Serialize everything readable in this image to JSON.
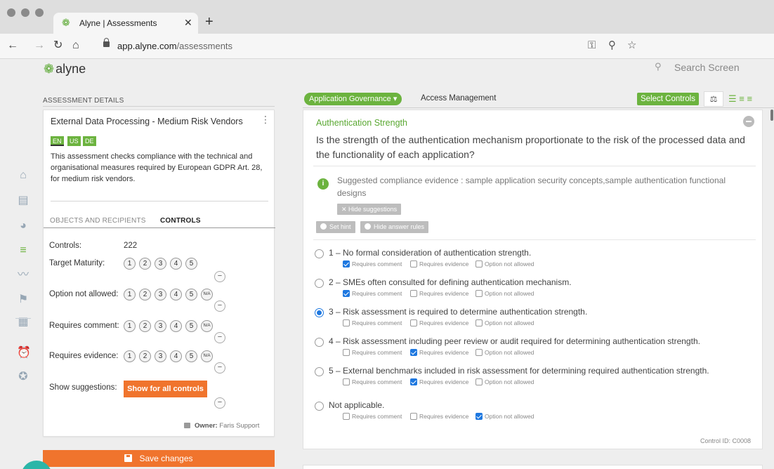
{
  "browser": {
    "tab_title": "Alyne | Assessments",
    "url_host": "app.alyne.com",
    "url_path": "/assessments"
  },
  "app": {
    "logo_text": "alyne",
    "search_placeholder": "Search Screen"
  },
  "left": {
    "section_title": "ASSESSMENT DETAILS",
    "assessment_title": "External Data Processing - Medium Risk Vendors",
    "languages": [
      "EN",
      "US",
      "DE"
    ],
    "description": "This assessment checks compliance with the technical and organisational measures required by European GDPR Art. 28, for medium risk vendors.",
    "tabs": [
      "OBJECTS AND RECIPIENTS",
      "CONTROLS"
    ],
    "controls_label": "Controls:",
    "controls_value": "222",
    "target_maturity_label": "Target Maturity:",
    "option_not_allowed_label": "Option not allowed:",
    "requires_comment_label": "Requires comment:",
    "requires_evidence_label": "Requires evidence:",
    "show_suggestions_label": "Show suggestions:",
    "show_all_button": "Show for all controls",
    "levels": [
      "1",
      "2",
      "3",
      "4",
      "5"
    ],
    "na_label": "N/A",
    "minus": "−",
    "owner_label": "Owner:",
    "owner_name": "Faris Support",
    "save_button": "Save changes"
  },
  "right": {
    "breadcrumb_active": "Application Governance ▾",
    "breadcrumb_next": "Access Management",
    "select_controls": "Select Controls",
    "control_title": "Authentication Strength",
    "question": "Is the strength of the authentication mechanism proportionate to the risk of the processed data and the functionality of each application?",
    "suggestion": "Suggested compliance evidence : sample application security concepts,sample authentication functional designs",
    "hide_suggestions": "✕  Hide suggestions",
    "set_hint": "Set hint",
    "hide_answer_rules": "Hide answer rules",
    "check_labels": [
      "Requires comment",
      "Requires evidence",
      "Option not allowed"
    ],
    "options": [
      {
        "text": "1 – No formal consideration of authentication strength."
      },
      {
        "text": "2 – SMEs often consulted for defining authentication mechanism."
      },
      {
        "text": "3 – Risk assessment is required to determine authentication strength."
      },
      {
        "text": "4 – Risk assessment including peer review or audit required for determining authentication strength."
      },
      {
        "text": "5 – External benchmarks included in risk assessment for determining required authentication strength."
      },
      {
        "text": "Not applicable."
      }
    ],
    "control_id": "Control ID: C0008"
  }
}
